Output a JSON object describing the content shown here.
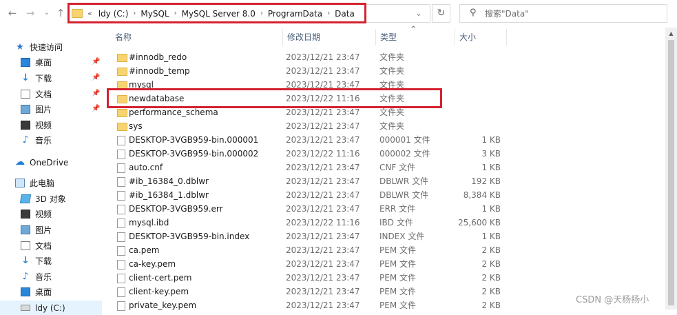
{
  "address": {
    "crumbs": [
      "ldy (C:)",
      "MySQL",
      "MySQL Server 8.0",
      "ProgramData",
      "Data"
    ],
    "overflow_glyph": "«",
    "separator": "›"
  },
  "search": {
    "placeholder": "搜索\"Data\""
  },
  "nav": {
    "quick_access": "快速访问",
    "quick_items": [
      {
        "label": "桌面",
        "icon": "desktop-icon",
        "pinned": true
      },
      {
        "label": "下载",
        "icon": "download-icon",
        "pinned": true
      },
      {
        "label": "文档",
        "icon": "document-icon",
        "pinned": true
      },
      {
        "label": "图片",
        "icon": "picture-icon",
        "pinned": true
      },
      {
        "label": "视频",
        "icon": "video-icon",
        "pinned": false
      },
      {
        "label": "音乐",
        "icon": "music-icon",
        "pinned": false
      }
    ],
    "onedrive": "OneDrive",
    "this_pc": "此电脑",
    "pc_items": [
      {
        "label": "3D 对象",
        "icon": "3d-objects-icon"
      },
      {
        "label": "视频",
        "icon": "video-icon"
      },
      {
        "label": "图片",
        "icon": "picture-icon"
      },
      {
        "label": "文档",
        "icon": "document-icon"
      },
      {
        "label": "下载",
        "icon": "download-icon"
      },
      {
        "label": "音乐",
        "icon": "music-icon"
      },
      {
        "label": "桌面",
        "icon": "desktop-icon"
      },
      {
        "label": "ldy (C:)",
        "icon": "drive-icon"
      }
    ]
  },
  "columns": {
    "name": "名称",
    "date": "修改日期",
    "type": "类型",
    "size": "大小"
  },
  "files": [
    {
      "name": "#innodb_redo",
      "date": "2023/12/21 23:47",
      "type": "文件夹",
      "size": "",
      "kind": "folder"
    },
    {
      "name": "#innodb_temp",
      "date": "2023/12/21 23:47",
      "type": "文件夹",
      "size": "",
      "kind": "folder"
    },
    {
      "name": "mysql",
      "date": "2023/12/21 23:47",
      "type": "文件夹",
      "size": "",
      "kind": "folder"
    },
    {
      "name": "newdatabase",
      "date": "2023/12/22 11:16",
      "type": "文件夹",
      "size": "",
      "kind": "folder"
    },
    {
      "name": "performance_schema",
      "date": "2023/12/21 23:47",
      "type": "文件夹",
      "size": "",
      "kind": "folder"
    },
    {
      "name": "sys",
      "date": "2023/12/21 23:47",
      "type": "文件夹",
      "size": "",
      "kind": "folder"
    },
    {
      "name": "DESKTOP-3VGB959-bin.000001",
      "date": "2023/12/21 23:47",
      "type": "000001 文件",
      "size": "1 KB",
      "kind": "file"
    },
    {
      "name": "DESKTOP-3VGB959-bin.000002",
      "date": "2023/12/22 11:16",
      "type": "000002 文件",
      "size": "3 KB",
      "kind": "file"
    },
    {
      "name": "auto.cnf",
      "date": "2023/12/21 23:47",
      "type": "CNF 文件",
      "size": "1 KB",
      "kind": "file"
    },
    {
      "name": "#ib_16384_0.dblwr",
      "date": "2023/12/21 23:47",
      "type": "DBLWR 文件",
      "size": "192 KB",
      "kind": "file"
    },
    {
      "name": "#ib_16384_1.dblwr",
      "date": "2023/12/21 23:47",
      "type": "DBLWR 文件",
      "size": "8,384 KB",
      "kind": "file"
    },
    {
      "name": "DESKTOP-3VGB959.err",
      "date": "2023/12/21 23:47",
      "type": "ERR 文件",
      "size": "1 KB",
      "kind": "file"
    },
    {
      "name": "mysql.ibd",
      "date": "2023/12/22 11:16",
      "type": "IBD 文件",
      "size": "25,600 KB",
      "kind": "file"
    },
    {
      "name": "DESKTOP-3VGB959-bin.index",
      "date": "2023/12/21 23:47",
      "type": "INDEX 文件",
      "size": "1 KB",
      "kind": "file"
    },
    {
      "name": "ca.pem",
      "date": "2023/12/21 23:47",
      "type": "PEM 文件",
      "size": "2 KB",
      "kind": "file"
    },
    {
      "name": "ca-key.pem",
      "date": "2023/12/21 23:47",
      "type": "PEM 文件",
      "size": "2 KB",
      "kind": "file"
    },
    {
      "name": "client-cert.pem",
      "date": "2023/12/21 23:47",
      "type": "PEM 文件",
      "size": "2 KB",
      "kind": "file"
    },
    {
      "name": "client-key.pem",
      "date": "2023/12/21 23:47",
      "type": "PEM 文件",
      "size": "2 KB",
      "kind": "file"
    },
    {
      "name": "private_key.pem",
      "date": "2023/12/21 23:47",
      "type": "PEM 文件",
      "size": "2 KB",
      "kind": "file"
    }
  ],
  "highlighted_file": "newdatabase",
  "watermark": "CSDN @天杨扬小",
  "colors": {
    "highlight": "#d3212f",
    "folder": "#f7d470",
    "accent": "#2a86db"
  }
}
